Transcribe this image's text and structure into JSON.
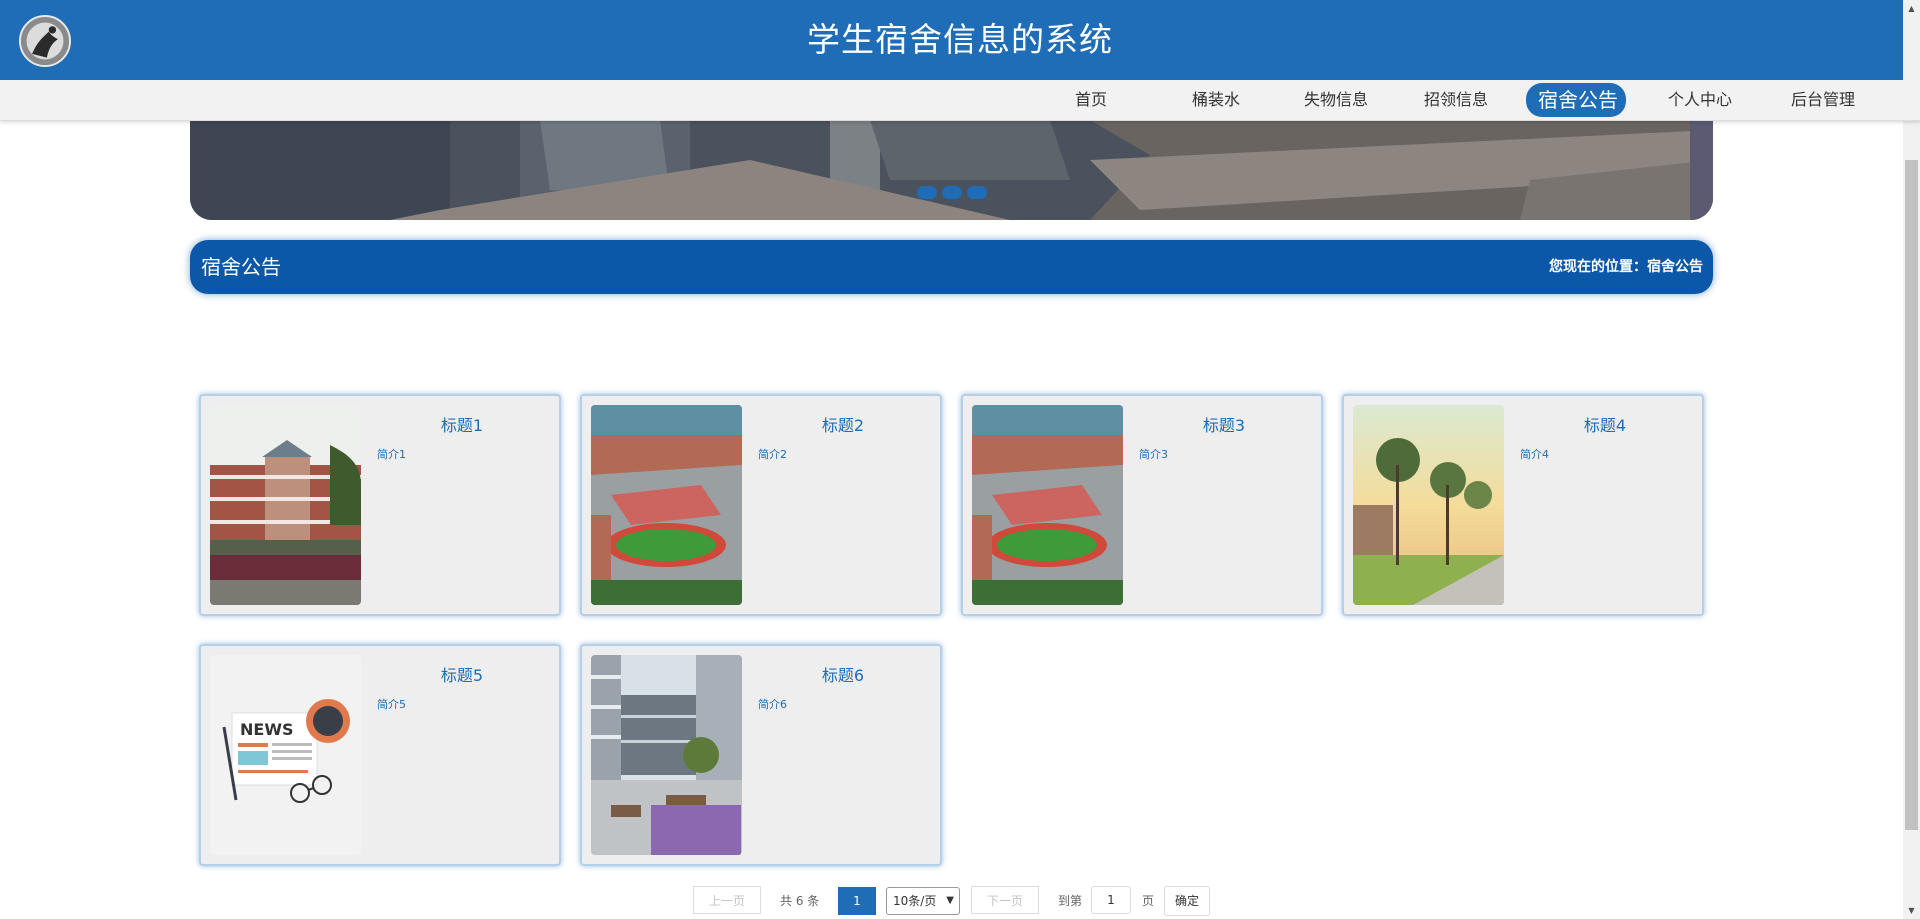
{
  "header": {
    "title": "学生宿舍信息的系统",
    "logo_icon": "avatar-logo-icon"
  },
  "nav": {
    "items": [
      {
        "label": "首页",
        "active": false
      },
      {
        "label": "桶装水",
        "active": false
      },
      {
        "label": "失物信息",
        "active": false
      },
      {
        "label": "招领信息",
        "active": false
      },
      {
        "label": "宿舍公告",
        "active": true
      },
      {
        "label": "个人中心",
        "active": false
      },
      {
        "label": "后台管理",
        "active": false
      }
    ]
  },
  "banner": {
    "slides": 3
  },
  "section": {
    "title": "宿舍公告",
    "breadcrumb": "您现在的位置：宿舍公告"
  },
  "cards": [
    {
      "title": "标题1",
      "desc": "简介1",
      "image_icon": "campus-building-image"
    },
    {
      "title": "标题2",
      "desc": "简介2",
      "image_icon": "campus-aerial-image"
    },
    {
      "title": "标题3",
      "desc": "简介3",
      "image_icon": "campus-aerial-image"
    },
    {
      "title": "标题4",
      "desc": "简介4",
      "image_icon": "trees-sunset-image"
    },
    {
      "title": "标题5",
      "desc": "简介5",
      "image_icon": "news-illustration-image"
    },
    {
      "title": "标题6",
      "desc": "简介6",
      "image_icon": "courtyard-image"
    }
  ],
  "pagination": {
    "prev_label": "上一页",
    "total_label": "共 6 条",
    "current_page": "1",
    "page_size_label": "10条/页",
    "next_label": "下一页",
    "goto_label": "到第",
    "goto_value": "1",
    "page_unit": "页",
    "confirm_label": "确定"
  },
  "colors": {
    "primary": "#1e6db6",
    "section_bar": "#0b58a8",
    "nav_bg": "#f2f2f2"
  }
}
